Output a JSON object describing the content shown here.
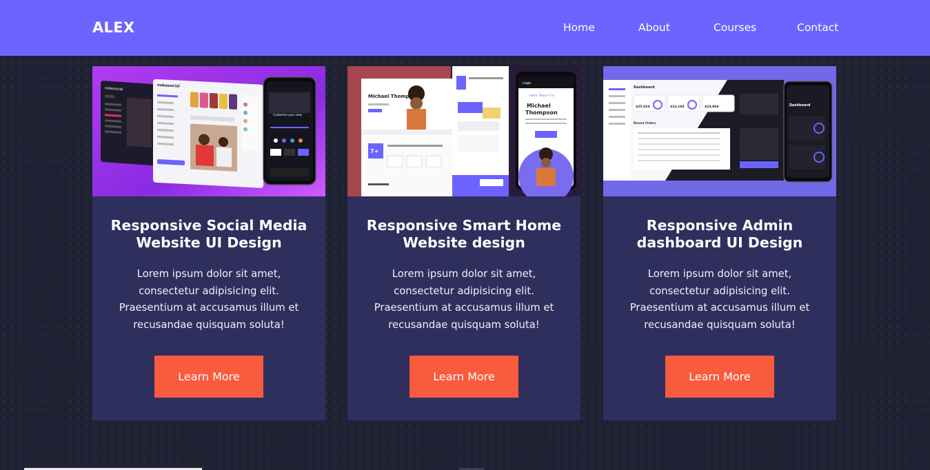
{
  "header": {
    "logo": "ALEX",
    "nav": [
      "Home",
      "About",
      "Courses",
      "Contact"
    ]
  },
  "cards": [
    {
      "title_line1": "Responsive Social Media",
      "title_line2": "Website UI Design",
      "text_lines": [
        "Lorem ipsum dolor sit amet,",
        "consectetur adipisicing elit.",
        "Praesentium at accusamus illum et",
        "recusandae quisquam soluta!"
      ],
      "button": "Learn More",
      "image": {
        "brand": "nokesocial"
      }
    },
    {
      "title_line1": "Responsive Smart Home",
      "title_line2": "Website design",
      "text_lines": [
        "Lorem ipsum dolor sit amet,",
        "consectetur adipisicing elit.",
        "Praesentium at accusamus illum et",
        "recusandae quisquam soluta!"
      ],
      "button": "Learn More",
      "image": {
        "name": "Michael Thompson",
        "greeting": "Hello There! I'm",
        "stat": "7+",
        "phone_logo": "Logo"
      }
    },
    {
      "title_line1": "Responsive Admin",
      "title_line2": "dashboard UI Design",
      "text_lines": [
        "Lorem ipsum dolor sit amet,",
        "consectetur adipisicing elit.",
        "Praesentium at accusamus illum et",
        "recusandae quisquam soluta!"
      ],
      "button": "Learn More",
      "image": {
        "heading": "Dashboard",
        "value1": "$25,024",
        "value2": "$14,160",
        "value3": "$10,864",
        "section": "Recent Orders"
      }
    }
  ],
  "colors": {
    "nav": "#6c63ff",
    "card": "#2f2f5e",
    "button": "#fa5a3d",
    "background": "#1f2233"
  }
}
